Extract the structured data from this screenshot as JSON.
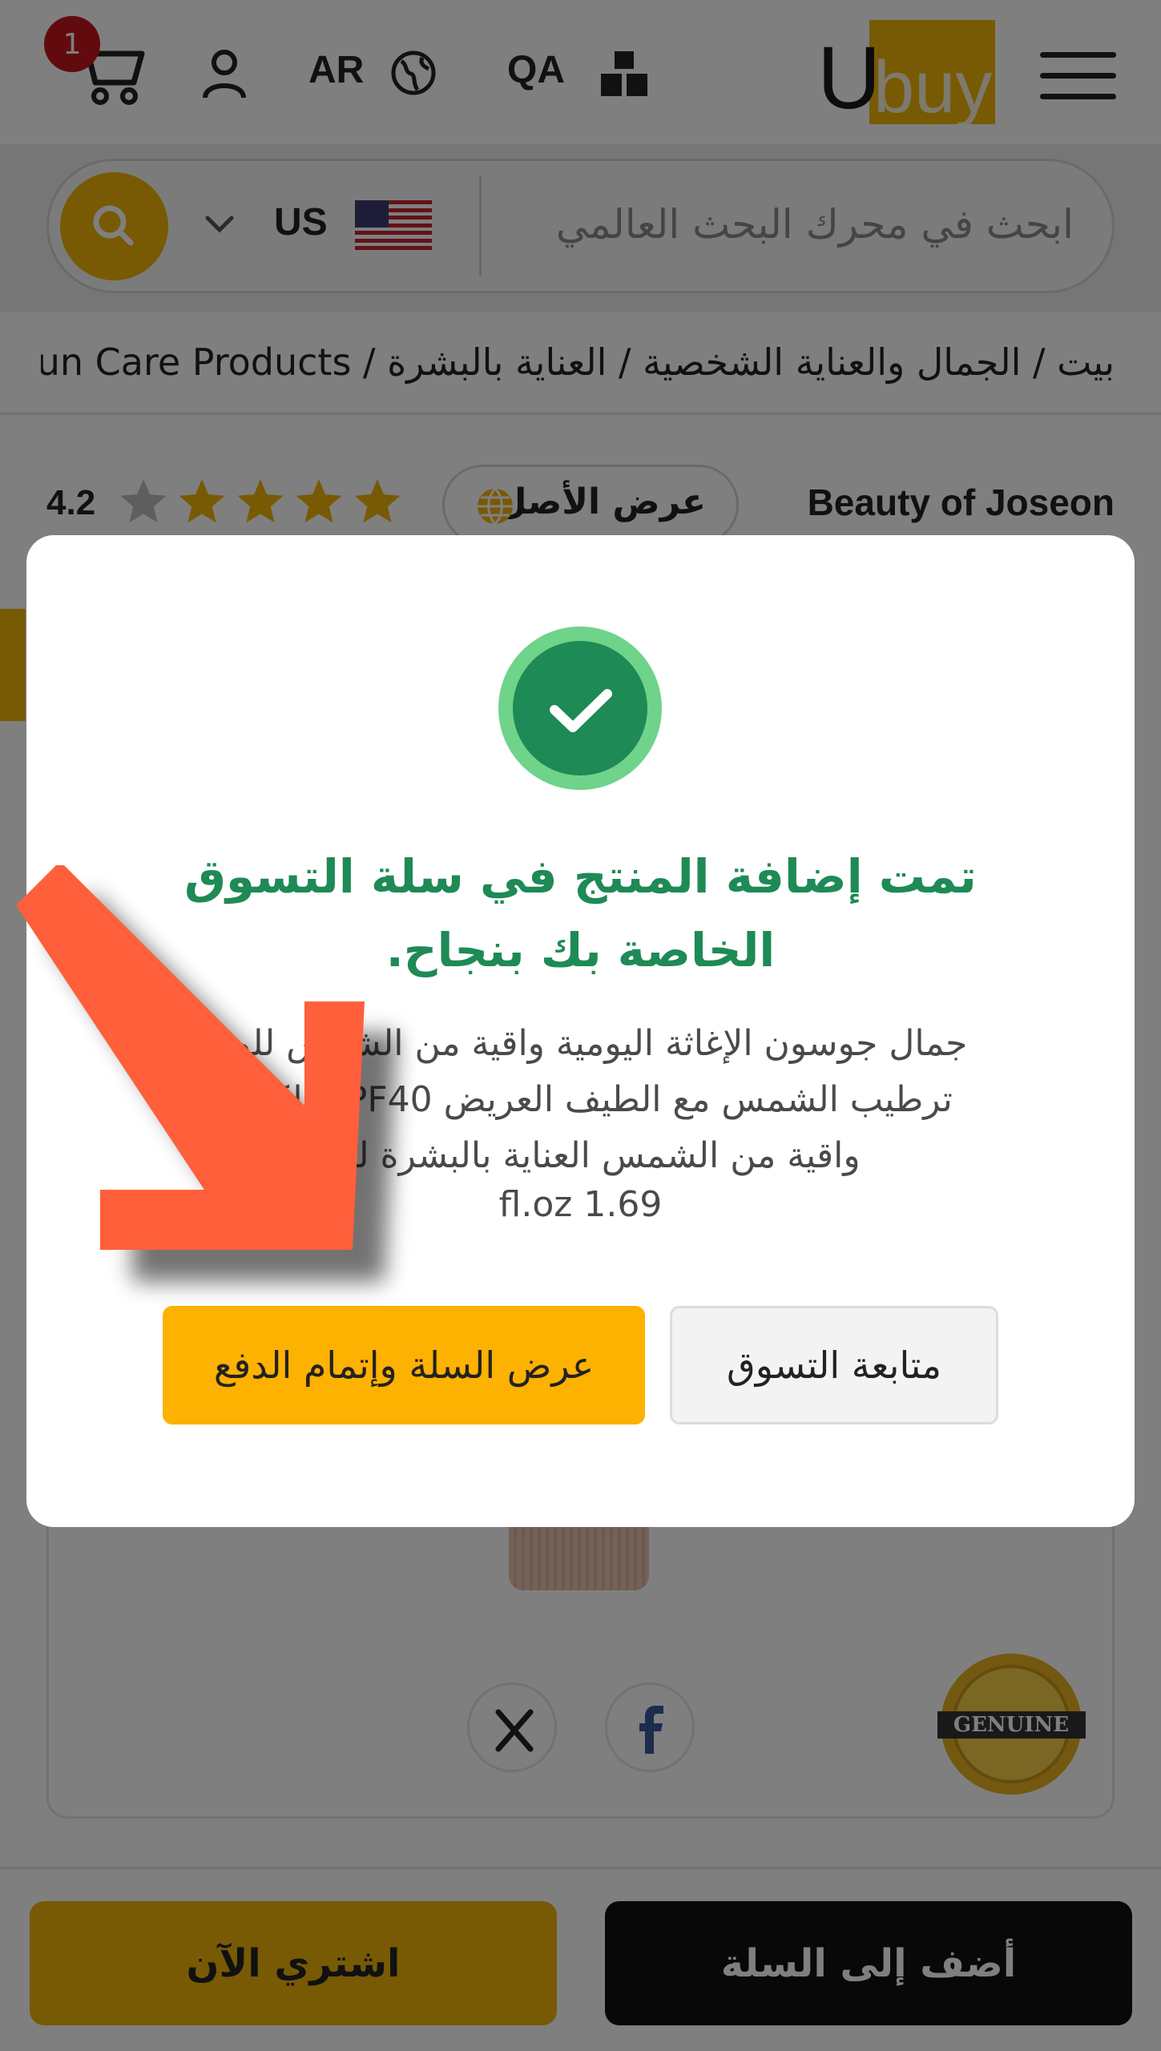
{
  "header": {
    "cart_count": "1",
    "language": "AR",
    "country": "QA",
    "logo_text_u": "U",
    "logo_text_buy": "buy"
  },
  "search": {
    "placeholder": "ابحث في محرك البحث العالمي",
    "store_code": "US"
  },
  "breadcrumb": {
    "text": "بيت / الجمال والعناية الشخصية / العناية بالبشرة / Sun Care Products..."
  },
  "product": {
    "brand": "Beauty of Joseon",
    "view_original": "عرض الأصل",
    "rating": "4.2",
    "rating_value": 4.2,
    "rating_max": 5
  },
  "modal": {
    "title": "تمت إضافة المنتج في سلة التسوق الخاصة بك بنجاح.",
    "description": "جمال جوسون الإغاثة اليومية واقية من الشمس للوجه ترطيب الشمس مع الطيف العريض SPF40 الكورية واقية من الشمس العناية بالبشرة لكل،",
    "size": "fl.oz 1.69",
    "checkout_label": "عرض السلة وإتمام الدفع",
    "continue_label": "متابعة التسوق"
  },
  "badges": {
    "genuine": "GENUINE"
  },
  "bottom_bar": {
    "buy_now": "اشتري الآن",
    "add_to_cart": "أضف إلى السلة"
  },
  "colors": {
    "brand_yellow": "#f1b40b",
    "success_green": "#1e8a55",
    "checkout_yellow": "#fdb100",
    "arrow_orange": "#ff5f3a"
  },
  "icons": [
    "cart-icon",
    "user-icon",
    "globe-icon",
    "boxes-icon",
    "menu-icon",
    "search-icon",
    "chevron-down-icon",
    "us-flag-icon",
    "star-icon",
    "check-icon",
    "x-logo-icon",
    "facebook-icon",
    "genuine-seal-icon",
    "arrow-annotation"
  ]
}
